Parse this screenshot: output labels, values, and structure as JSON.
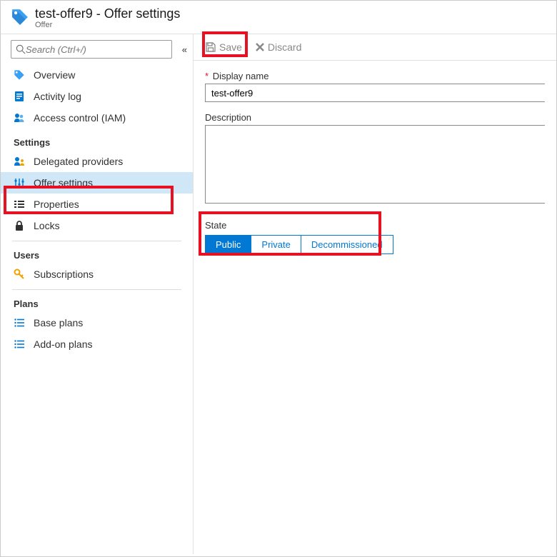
{
  "header": {
    "title": "test-offer9 - Offer settings",
    "subtitle": "Offer"
  },
  "search": {
    "placeholder": "Search (Ctrl+/)"
  },
  "sidebar": {
    "overview": "Overview",
    "activity_log": "Activity log",
    "access_control": "Access control (IAM)",
    "section_settings": "Settings",
    "delegated_providers": "Delegated providers",
    "offer_settings": "Offer settings",
    "properties": "Properties",
    "locks": "Locks",
    "section_users": "Users",
    "subscriptions": "Subscriptions",
    "section_plans": "Plans",
    "base_plans": "Base plans",
    "addon_plans": "Add-on plans"
  },
  "toolbar": {
    "save": "Save",
    "discard": "Discard"
  },
  "form": {
    "display_name_label": "Display name",
    "display_name_value": "test-offer9",
    "description_label": "Description",
    "description_value": "",
    "state_label": "State",
    "state_public": "Public",
    "state_private": "Private",
    "state_decommissioned": "Decommissioned"
  }
}
